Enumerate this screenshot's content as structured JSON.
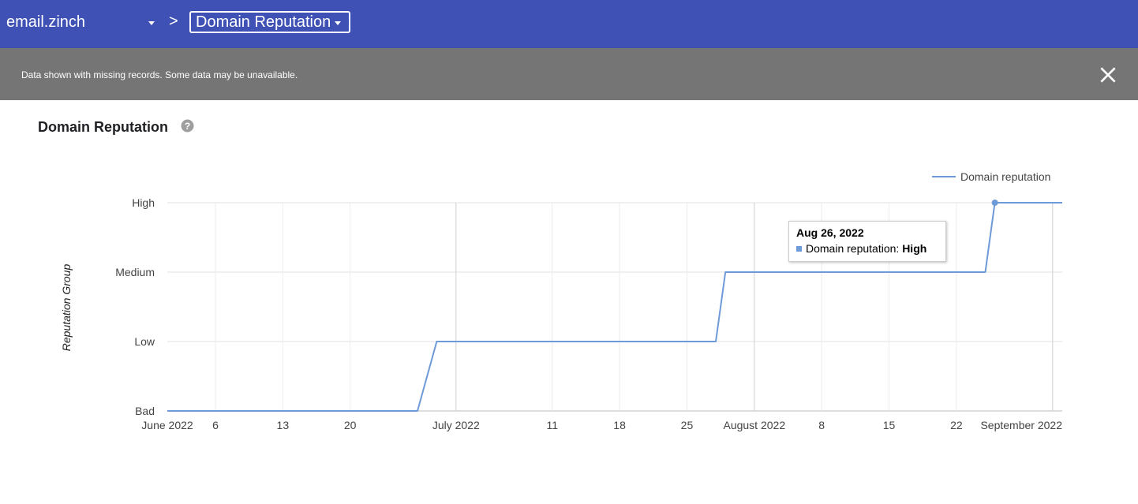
{
  "header": {
    "property_name": "email.zinch",
    "breadcrumb_separator": ">",
    "report_selector": "Domain Reputation"
  },
  "notice": {
    "text": "Data shown with missing records. Some data may be unavailable."
  },
  "icons": {
    "property_dropdown": "caret-down-icon",
    "breadcrumb": "chevron-right-icon",
    "report_dropdown": "caret-down-icon",
    "notice_close": "close-icon",
    "help": "help-circle-icon"
  },
  "section": {
    "title": "Domain Reputation"
  },
  "colors": {
    "header_bg": "#3f51b5",
    "notice_bg": "#757575",
    "series": "#6f9ad8",
    "grid": "#e0e0e0"
  },
  "tooltip": {
    "date": "Aug 26, 2022",
    "series_label": "Domain reputation:",
    "value": "High"
  },
  "chart_data": {
    "type": "line",
    "ylabel": "Reputation Group",
    "y_categories": [
      "Bad",
      "Low",
      "Medium",
      "High"
    ],
    "legend": {
      "position": "top-right",
      "entries": [
        "Domain reputation"
      ]
    },
    "grid": true,
    "x_range": [
      "2022-06-01",
      "2022-09-02"
    ],
    "x_tick_labels": [
      {
        "date": "2022-06-01",
        "label": "June 2022"
      },
      {
        "date": "2022-06-06",
        "label": "6"
      },
      {
        "date": "2022-06-13",
        "label": "13"
      },
      {
        "date": "2022-06-20",
        "label": "20"
      },
      {
        "date": "2022-07-01",
        "label": "July 2022"
      },
      {
        "date": "2022-07-11",
        "label": "11"
      },
      {
        "date": "2022-07-18",
        "label": "18"
      },
      {
        "date": "2022-07-25",
        "label": "25"
      },
      {
        "date": "2022-08-01",
        "label": "August 2022"
      },
      {
        "date": "2022-08-08",
        "label": "8"
      },
      {
        "date": "2022-08-15",
        "label": "15"
      },
      {
        "date": "2022-08-22",
        "label": "22"
      },
      {
        "date": "2022-09-01",
        "label": "September 2022"
      }
    ],
    "series": [
      {
        "name": "Domain reputation",
        "points": [
          {
            "x": "2022-06-01",
            "y": "Bad"
          },
          {
            "x": "2022-06-27",
            "y": "Bad"
          },
          {
            "x": "2022-06-29",
            "y": "Low"
          },
          {
            "x": "2022-07-28",
            "y": "Low"
          },
          {
            "x": "2022-07-29",
            "y": "Medium"
          },
          {
            "x": "2022-08-25",
            "y": "Medium"
          },
          {
            "x": "2022-08-26",
            "y": "High"
          },
          {
            "x": "2022-09-02",
            "y": "High"
          }
        ]
      }
    ],
    "highlighted_point": {
      "x": "2022-08-26",
      "y": "High"
    }
  }
}
